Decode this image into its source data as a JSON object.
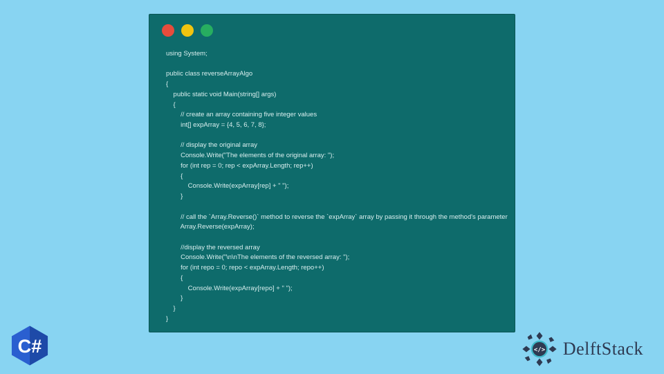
{
  "code": {
    "lines": [
      "using System;",
      "",
      "public class reverseArrayAlgo",
      "{",
      "    public static void Main(string[] args)",
      "    {",
      "        // create an array containing five integer values",
      "        int[] expArray = {4, 5, 6, 7, 8};",
      "",
      "        // display the original array",
      "        Console.Write(\"The elements of the original array: \");",
      "        for (int rep = 0; rep < expArray.Length; rep++)",
      "        {",
      "            Console.Write(expArray[rep] + \" \");",
      "        }",
      "",
      "        // call the `Array.Reverse()` method to reverse the `expArray` array by passing it through the method's parameter",
      "        Array.Reverse(expArray);",
      "",
      "        //display the reversed array",
      "        Console.Write(\"\\n\\nThe elements of the reversed array: \");",
      "        for (int repo = 0; repo < expArray.Length; repo++)",
      "        {",
      "            Console.Write(expArray[repo] + \" \");",
      "        }",
      "    }",
      "}"
    ]
  },
  "badge": {
    "label": "C#"
  },
  "logo": {
    "text": "DelftStack",
    "symbol": "</>"
  }
}
